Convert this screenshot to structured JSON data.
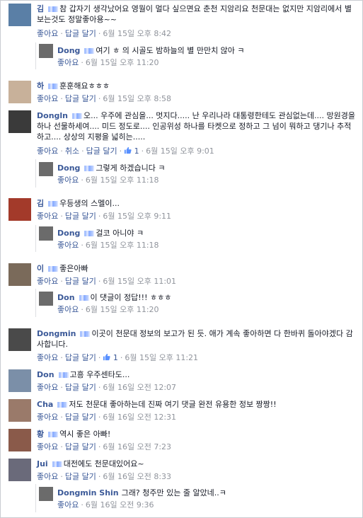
{
  "labels": {
    "like": "좋아요",
    "reply": "답글 달기",
    "cancel_like": "취소",
    "separator": "·"
  },
  "comments": [
    {
      "name": "김",
      "text": "참 갑자기 생각났어요 영월이 멀다 싶으면요 춘천 지암리요 천문대는 없지만 지암리에서 별보는것도 정말좋아용~~",
      "time": "6월 15일 오후 8:42",
      "avatar_color": "#5a7fa6"
    },
    {
      "name": "Dong",
      "text": "여기 ㅎ   의 시골도 밤하늘의 별 만만치 않아 ㅋ",
      "time": "6월 15일 오후 11:20",
      "avatar_color": "#6b6b6b",
      "reply": true
    },
    {
      "name": "하",
      "text": "훈훈해요ㅎㅎㅎ",
      "time": "6월 15일 오후 8:58",
      "avatar_color": "#c8b19a"
    },
    {
      "name": "Dongln",
      "text": "오... 우주에 관심을... 멋지다..... 난 우리나라 대통령한테도 관심없는데.... 망원경을 하나 선물하세여.... 미드 정도로.... 인공위성 하나를 타켓으로 정하고 그 넘이 뭐하고 댕기나 추적하고.... 상상의 지평을 넓히는.....",
      "time": "6월 15일 오후 9:01",
      "avatar_color": "#3a3a3a",
      "liked": true,
      "like_count": "1"
    },
    {
      "name": "Dong",
      "text": "그렇게 하겠습니다 ㅋ",
      "time": "6월 15일 오후 11:18",
      "avatar_color": "#6b6b6b",
      "reply": true
    },
    {
      "name": "김",
      "text": "우등생의 스멜이...",
      "time": "6월 15일 오후 9:11",
      "avatar_color": "#a33a2a"
    },
    {
      "name": "Dong",
      "text": "걸코 아니야 ㅋ",
      "time": "6월 15일 오후 11:18",
      "avatar_color": "#6b6b6b",
      "reply": true
    },
    {
      "name": "이",
      "text": "좋은아빠",
      "time": "6월 15일 오후 11:01",
      "avatar_color": "#7a6a5a"
    },
    {
      "name": "Don",
      "text": "이 댓글이 정답!!! ㅎㅎㅎ",
      "time": "6월 15일 오후 11:20",
      "avatar_color": "#6b6b6b",
      "reply": true
    },
    {
      "name": "Dongmin",
      "text": "이곳이 천문대 정보의 보고가 된 듯. 애가 계속 좋아하면 다 한바퀴 돌아야겠다 감사합니다.",
      "time": "6월 15일 오후 11:21",
      "avatar_color": "#4a4a4a",
      "like_count": "1",
      "liked_display": true
    },
    {
      "name": "Don",
      "text": "고흥 우주센타도...",
      "time": "6월 16일 오전 12:07",
      "avatar_color": "#7b8fa8"
    },
    {
      "name": "Cha",
      "text": "저도 천문대 좋아하는데 진짜 여기 댓글 완전 유용한 정보 짱짱!!",
      "time": "6월 16일 오전 12:31",
      "avatar_color": "#9a7a6a"
    },
    {
      "name": "황",
      "text": "역시 좋은 아빠!",
      "time": "6월 16일 오전 7:23",
      "avatar_color": "#8a5a4a"
    },
    {
      "name": "Jui",
      "text": "대전에도 천문대있어요~",
      "time": "6월 16일 오전 8:33",
      "avatar_color": "#6a6a7a"
    },
    {
      "name": "Dongmin Shin",
      "text": "그래? 청주만 있는 줄 알았네..ㅋ",
      "time": "6월 16일 오전 9:36",
      "avatar_color": "#6b6b6b",
      "reply": true
    }
  ]
}
